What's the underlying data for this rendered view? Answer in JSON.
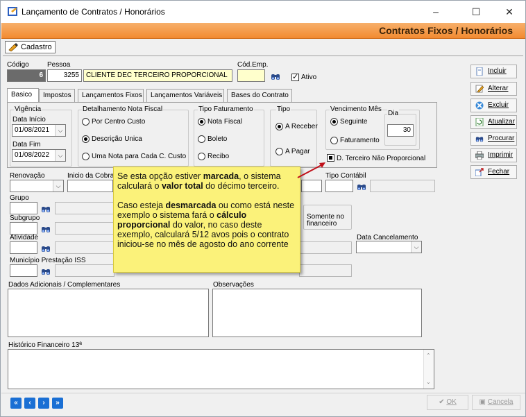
{
  "window": {
    "title": "Lançamento de Contratos / Honorários",
    "minimize": "–",
    "maximize": "☐",
    "close": "✕"
  },
  "header": {
    "title": "Contratos Fixos / Honorários"
  },
  "cadastro_tab": "Cadastro",
  "fields": {
    "codigo_label": "Código",
    "codigo_value": "6",
    "pessoa_label": "Pessoa",
    "pessoa_code": "3255",
    "pessoa_name": "CLIENTE DEC TERCEIRO PROPORCIONAL",
    "cod_emp_label": "Cód.Emp.",
    "cod_emp_value": "",
    "ativo_label": "Ativo"
  },
  "tabs": [
    {
      "label": "Basico"
    },
    {
      "label": "Impostos"
    },
    {
      "label": "Lançamentos Fixos"
    },
    {
      "label": "Lançamentos Variáveis"
    },
    {
      "label": "Bases do Contrato"
    }
  ],
  "basico": {
    "vigencia_label": "Vigência",
    "data_inicio_label": "Data Início",
    "data_inicio_value": "01/08/2021",
    "data_fim_label": "Data Fim",
    "data_fim_value": "01/08/2022",
    "detalhamento_label": "Detalhamento Nota Fiscal",
    "detalhamento_options": [
      "Por Centro Custo",
      "Descrição Unica",
      "Uma Nota para Cada C. Custo"
    ],
    "detalhamento_selected": 1,
    "tipo_fat_label": "Tipo Faturamento",
    "tipo_fat_options": [
      "Nota Fiscal",
      "Boleto",
      "Recibo"
    ],
    "tipo_fat_selected": 0,
    "tipo_label": "Tipo",
    "tipo_options": [
      "A Receber",
      "A Pagar"
    ],
    "tipo_selected": 0,
    "vencimento_label": "Vencimento Mês",
    "vencimento_options": [
      "Seguinte",
      "Faturamento"
    ],
    "vencimento_selected": 0,
    "dia_label": "Dia",
    "dia_value": "30",
    "dterceiro_label": "D. Terceiro Não Proporcional"
  },
  "lower": {
    "renovacao_label": "Renovação",
    "inicio_cobranca_label": "Inicio da Cobran",
    "tipo_contabil_label": "Tipo Contábil",
    "grupo_label": "Grupo",
    "subgrupo_label": "Subgrupo",
    "somente_label": "Somente no financeiro",
    "atividade_label": "Atividade",
    "data_cancelamento_label": "Data Cancelamento",
    "municipio_label": "Município Prestação ISS",
    "dados_label": "Dados Adicionais / Complementares",
    "observacoes_label": "Observações",
    "historico_label": "Histórico Financeiro 13ª"
  },
  "sidebar": [
    {
      "label": "Incluir",
      "icon": "document-icon"
    },
    {
      "label": "Alterar",
      "icon": "pencil-icon"
    },
    {
      "label": "Excluir",
      "icon": "delete-icon"
    },
    {
      "label": "Atualizar",
      "icon": "refresh-icon"
    },
    {
      "label": "Procurar",
      "icon": "binoculars-icon"
    },
    {
      "label": "Imprimir",
      "icon": "printer-icon"
    },
    {
      "label": "Fechar",
      "icon": "exit-icon"
    }
  ],
  "nav": [
    "«",
    "‹",
    "›",
    "»"
  ],
  "footer": {
    "ok": "OK",
    "cancel": "Cancela"
  },
  "tooltip": {
    "p1_a": "Se esta opção estiver ",
    "p1_b": "marcada",
    "p1_c": ", o sistema calculará o ",
    "p1_d": "valor total",
    "p1_e": " do décimo terceiro.",
    "p2_a": "Caso esteja ",
    "p2_b": "desmarcada",
    "p2_c": " ou como está neste exemplo o sistema fará o ",
    "p2_d": "cálculo proporcional",
    "p2_e": " do valor, no caso deste exemplo, calculará 5/12 avos pois o contrato iniciou-se no mês de agosto do ano corrente"
  },
  "colors": {
    "header_orange": "#f28a30",
    "tooltip_yellow": "#fbf27a",
    "nav_blue": "#1a6fd4",
    "arrow_red": "#c0101a"
  }
}
